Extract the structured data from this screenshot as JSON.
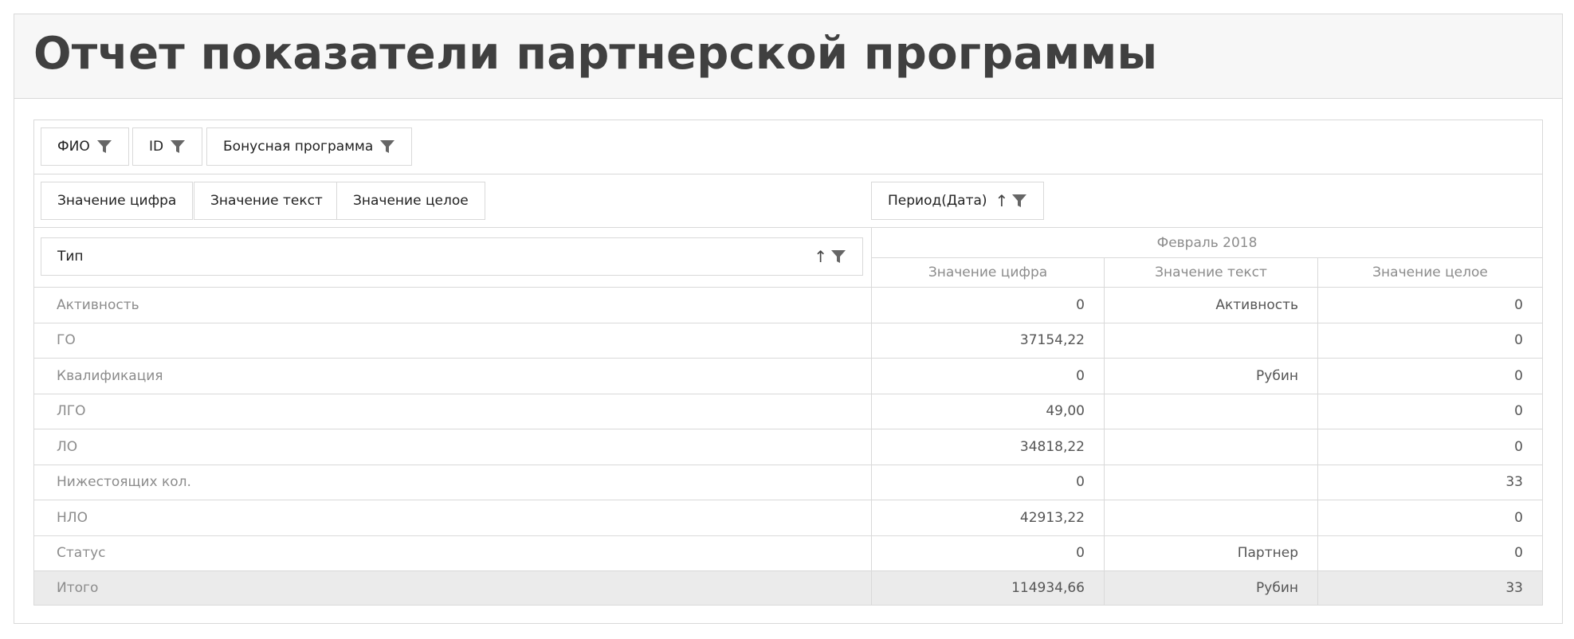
{
  "title": "Отчет показатели партнерской программы",
  "filters": {
    "row1": [
      "ФИО",
      "ID",
      "Бонусная программа"
    ],
    "row2": [
      "Значение цифра",
      "Значение текст",
      "Значение целое"
    ],
    "period": "Период(Дата)"
  },
  "row_header": "Тип",
  "period_label": "Февраль 2018",
  "columns": [
    "Значение цифра",
    "Значение текст",
    "Значение целое"
  ],
  "rows": [
    {
      "type": "Активность",
      "num": "0",
      "text": "Активность",
      "int": "0"
    },
    {
      "type": "ГО",
      "num": "37154,22",
      "text": "",
      "int": "0"
    },
    {
      "type": "Квалификация",
      "num": "0",
      "text": "Рубин",
      "int": "0"
    },
    {
      "type": "ЛГО",
      "num": "49,00",
      "text": "",
      "int": "0"
    },
    {
      "type": "ЛО",
      "num": "34818,22",
      "text": "",
      "int": "0"
    },
    {
      "type": "Нижестоящих кол.",
      "num": "0",
      "text": "",
      "int": "33"
    },
    {
      "type": "НЛО",
      "num": "42913,22",
      "text": "",
      "int": "0"
    },
    {
      "type": "Статус",
      "num": "0",
      "text": "Партнер",
      "int": "0"
    }
  ],
  "total": {
    "type": "Итого",
    "num": "114934,66",
    "text": "Рубин",
    "int": "33"
  },
  "icons": {
    "filter": "filter-funnel-icon",
    "sort": "sort-ascending-icon"
  },
  "colors": {
    "header_bg": "#f7f7f7",
    "border": "#d9d9d9",
    "total_bg": "#ebebeb",
    "muted_text": "#8c8c8c",
    "title": "#404040"
  }
}
